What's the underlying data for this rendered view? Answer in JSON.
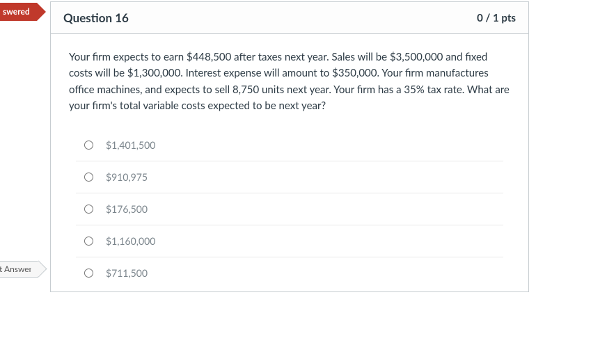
{
  "badges": {
    "unanswered": "swered",
    "correct": "t Answer"
  },
  "header": {
    "title": "Question 16",
    "points": "0 / 1 pts"
  },
  "body": {
    "text": "Your firm expects to earn $448,500 after taxes next year. Sales will be $3,500,000 and fixed costs will be $1,300,000. Interest expense will amount to $350,000. Your firm manufactures office machines, and expects to sell 8,750 units next year. Your firm has a 35% tax rate. What are your firm's total variable costs expected to be next year?"
  },
  "options": [
    {
      "label": "$1,401,500"
    },
    {
      "label": "$910,975"
    },
    {
      "label": "$176,500"
    },
    {
      "label": "$1,160,000"
    },
    {
      "label": "$711,500"
    }
  ]
}
